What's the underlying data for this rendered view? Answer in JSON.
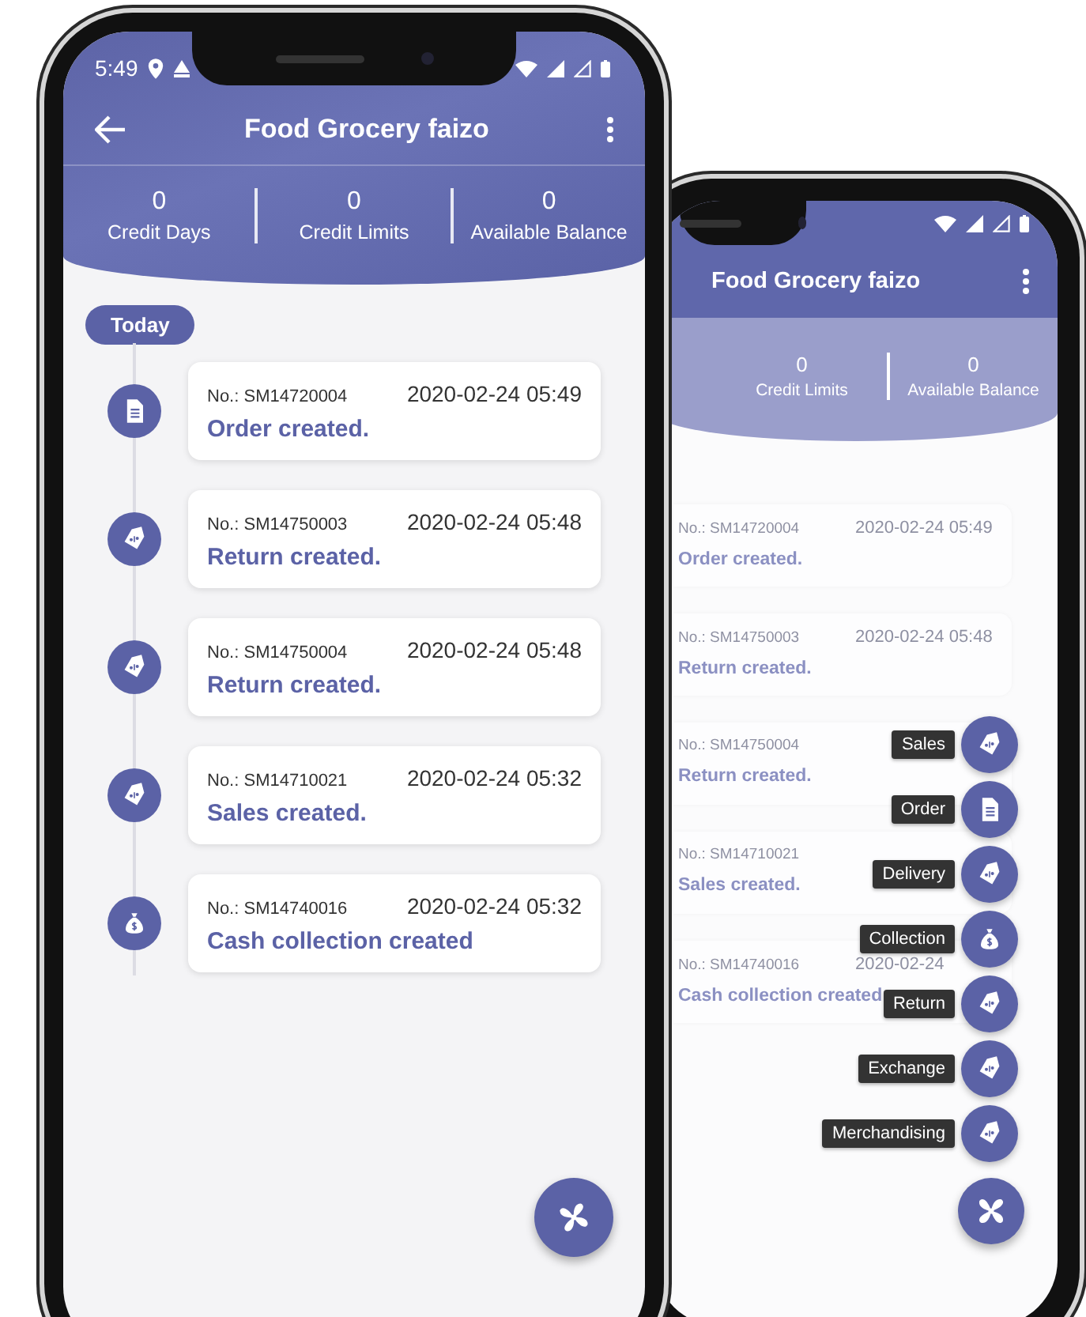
{
  "phones": [
    {
      "status_bar": {
        "time": "5:49"
      },
      "app_bar": {
        "title": "Food Grocery faizo",
        "back": true
      },
      "stats": [
        {
          "value": "0",
          "label": "Credit Days"
        },
        {
          "value": "0",
          "label": "Credit Limits"
        },
        {
          "value": "0",
          "label": "Available Balance"
        }
      ],
      "date_chip": "Today",
      "timeline": [
        {
          "kind": "order",
          "number": "No.: SM14720004",
          "time": "2020-02-24 05:49",
          "title": "Order created."
        },
        {
          "kind": "tag",
          "number": "No.: SM14750003",
          "time": "2020-02-24 05:48",
          "title": "Return created."
        },
        {
          "kind": "tag",
          "number": "No.: SM14750004",
          "time": "2020-02-24 05:48",
          "title": "Return created."
        },
        {
          "kind": "tag",
          "number": "No.: SM14710021",
          "time": "2020-02-24 05:32",
          "title": "Sales created."
        },
        {
          "kind": "money",
          "number": "No.: SM14740016",
          "time": "2020-02-24 05:32",
          "title": "Cash collection created"
        }
      ],
      "fab": {
        "expanded": false
      }
    },
    {
      "app_bar": {
        "title": "Food Grocery faizo",
        "back": false
      },
      "stats": [
        {
          "value": "0",
          "label": "Credit Limits"
        },
        {
          "value": "0",
          "label": "Available Balance"
        }
      ],
      "timeline": [
        {
          "number": "No.: SM14720004",
          "time": "2020-02-24 05:49",
          "title": "Order created."
        },
        {
          "number": "No.: SM14750003",
          "time": "2020-02-24 05:48",
          "title": "Return created."
        },
        {
          "number": "No.: SM14750004",
          "title": "Return created."
        },
        {
          "number": "No.: SM14710021",
          "title": "Sales created."
        },
        {
          "number": "No.: SM14740016",
          "time": "2020-02-24",
          "title": "Cash collection created"
        }
      ],
      "fab": {
        "expanded": true,
        "actions": [
          {
            "label": "Sales",
            "kind": "tag"
          },
          {
            "label": "Order",
            "kind": "order"
          },
          {
            "label": "Delivery",
            "kind": "tag"
          },
          {
            "label": "Collection",
            "kind": "money"
          },
          {
            "label": "Return",
            "kind": "tag"
          },
          {
            "label": "Exchange",
            "kind": "tag"
          },
          {
            "label": "Merchandising",
            "kind": "tag"
          }
        ]
      }
    }
  ]
}
